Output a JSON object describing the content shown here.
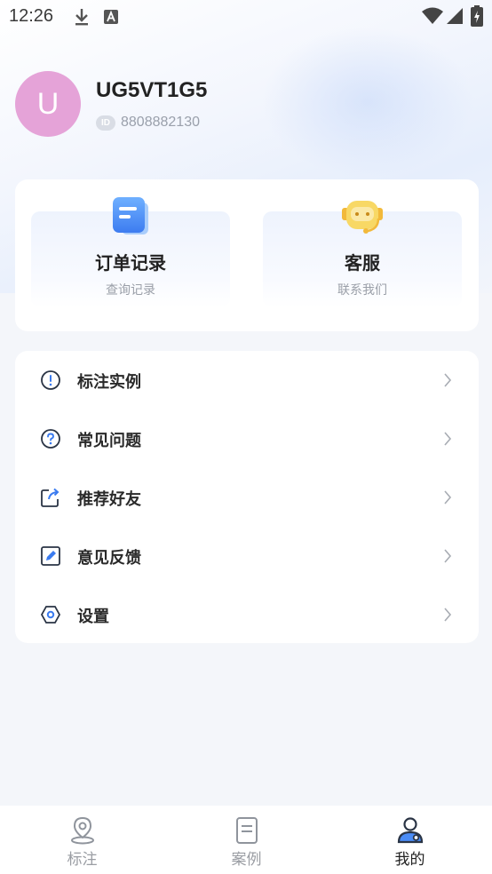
{
  "status_bar": {
    "time": "12:26"
  },
  "profile": {
    "avatar_letter": "U",
    "username": "UG5VT1G5",
    "id_badge": "ID",
    "user_id": "8808882130"
  },
  "quick_actions": [
    {
      "title": "订单记录",
      "subtitle": "查询记录",
      "icon": "order-list-icon"
    },
    {
      "title": "客服",
      "subtitle": "联系我们",
      "icon": "customer-service-robot-icon"
    }
  ],
  "menu": [
    {
      "label": "标注实例",
      "icon": "exclamation-circle-icon"
    },
    {
      "label": "常见问题",
      "icon": "question-circle-icon"
    },
    {
      "label": "推荐好友",
      "icon": "share-icon"
    },
    {
      "label": "意见反馈",
      "icon": "edit-feedback-icon"
    },
    {
      "label": "设置",
      "icon": "hexagon-settings-icon"
    }
  ],
  "tabs": [
    {
      "label": "标注",
      "icon": "location-pin-icon",
      "active": false
    },
    {
      "label": "案例",
      "icon": "document-icon",
      "active": false
    },
    {
      "label": "我的",
      "icon": "profile-icon",
      "active": true
    }
  ],
  "colors": {
    "avatar": "#e5a3d8",
    "primary_blue": "#4a8cf7",
    "robot_yellow": "#f7d25a",
    "text_dark": "#222222",
    "text_gray": "#9a9fa8"
  }
}
